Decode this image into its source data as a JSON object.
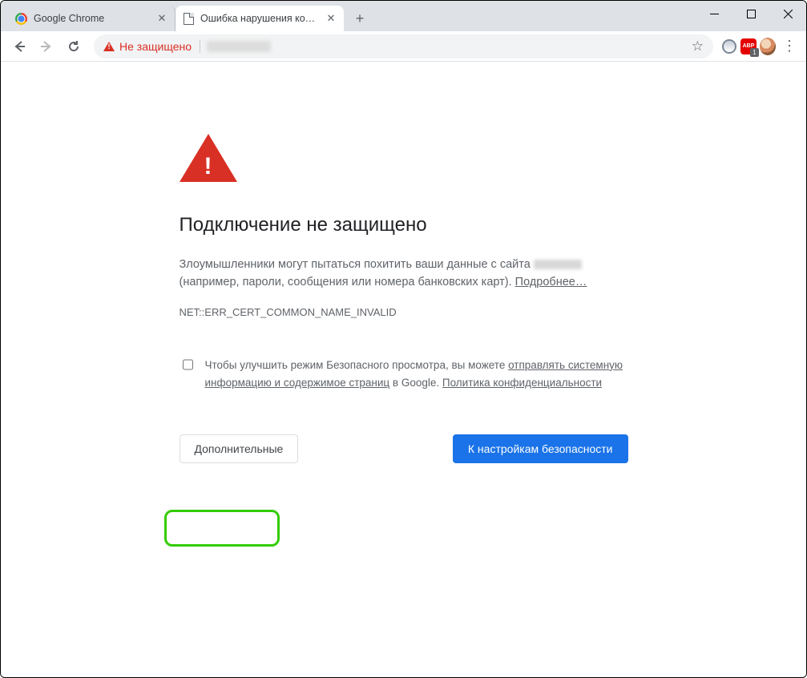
{
  "tabs": [
    {
      "label": "Google Chrome",
      "active": false
    },
    {
      "label": "Ошибка нарушения конфиденц",
      "active": true
    }
  ],
  "toolbar": {
    "not_secure_label": "Не защищено"
  },
  "extensions": {
    "abp_badge": "1"
  },
  "page": {
    "heading": "Подключение не защищено",
    "desc_prefix": "Злоумышленники могут пытаться похитить ваши данные с сайта ",
    "desc_suffix": " (например, пароли, сообщения или номера банковских карт). ",
    "learn_more": "Подробнее…",
    "error_code": "NET::ERR_CERT_COMMON_NAME_INVALID",
    "optin_prefix": "Чтобы улучшить режим Безопасного просмотра, вы можете ",
    "optin_link1": "отправлять системную информацию и содержимое страниц",
    "optin_mid": " в Google. ",
    "optin_link2": "Политика конфиденциальности",
    "btn_advanced": "Дополнительные",
    "btn_back": "К настройкам безопасности"
  }
}
